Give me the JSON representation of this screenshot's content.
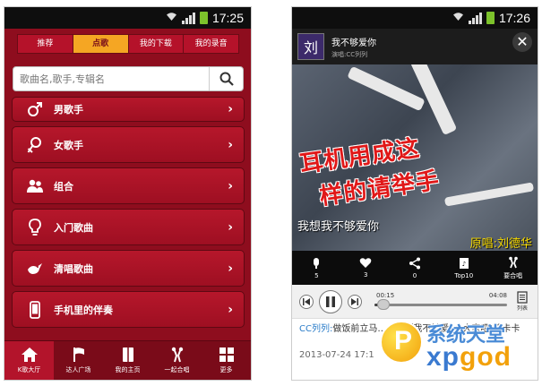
{
  "status_bar": {
    "left_time": "17:25",
    "right_time": "17:26"
  },
  "left": {
    "tabs": [
      {
        "label": "推荐",
        "active": false
      },
      {
        "label": "点歌",
        "active": true
      },
      {
        "label": "我的下载",
        "active": false
      },
      {
        "label": "我的录音",
        "active": false
      }
    ],
    "search": {
      "placeholder": "歌曲名,歌手,专辑名"
    },
    "menu": [
      {
        "label": "男歌手",
        "icon": "male-icon"
      },
      {
        "label": "女歌手",
        "icon": "female-icon"
      },
      {
        "label": "组合",
        "icon": "group-icon"
      },
      {
        "label": "入门歌曲",
        "icon": "bulb-icon"
      },
      {
        "label": "清唱歌曲",
        "icon": "bird-icon"
      },
      {
        "label": "手机里的伴奏",
        "icon": "phone-icon"
      }
    ],
    "bottom_nav": [
      {
        "label": "K歌大厅",
        "icon": "home-icon",
        "active": true
      },
      {
        "label": "达人广场",
        "icon": "flag-icon",
        "active": false
      },
      {
        "label": "我的主页",
        "icon": "book-icon",
        "active": false
      },
      {
        "label": "一起合唱",
        "icon": "chorus-icon",
        "active": false
      },
      {
        "label": "更多",
        "icon": "grid-icon",
        "active": false
      }
    ]
  },
  "right": {
    "song": {
      "cover_char": "刘",
      "title": "我不够爱你",
      "singer": "演唱:CC列列"
    },
    "video": {
      "caption_line1": "耳机用成这",
      "caption_line2": "样的请举手",
      "lyric": "我想我不够爱你",
      "original": "原唱:刘德华"
    },
    "actions": [
      {
        "label": "5",
        "icon": "mic-icon"
      },
      {
        "label": "3",
        "icon": "heart-icon"
      },
      {
        "label": "0",
        "icon": "share-icon"
      },
      {
        "label": "Top10",
        "icon": "top10-icon"
      },
      {
        "label": "要合唱",
        "icon": "chorus-icon"
      }
    ],
    "player": {
      "current": "00:15",
      "total": "04:08",
      "progress": 0.07,
      "list_label": "列表"
    },
    "comment": {
      "user": "CC列列:",
      "text": "做饭前立马……个「我不够爱」」大家吧!哇卡卡",
      "time": "2013-07-24 17:1"
    }
  },
  "watermark": {
    "logo_char": "P",
    "cn": "系统天堂",
    "en_a": "xp",
    "en_b": "god"
  }
}
